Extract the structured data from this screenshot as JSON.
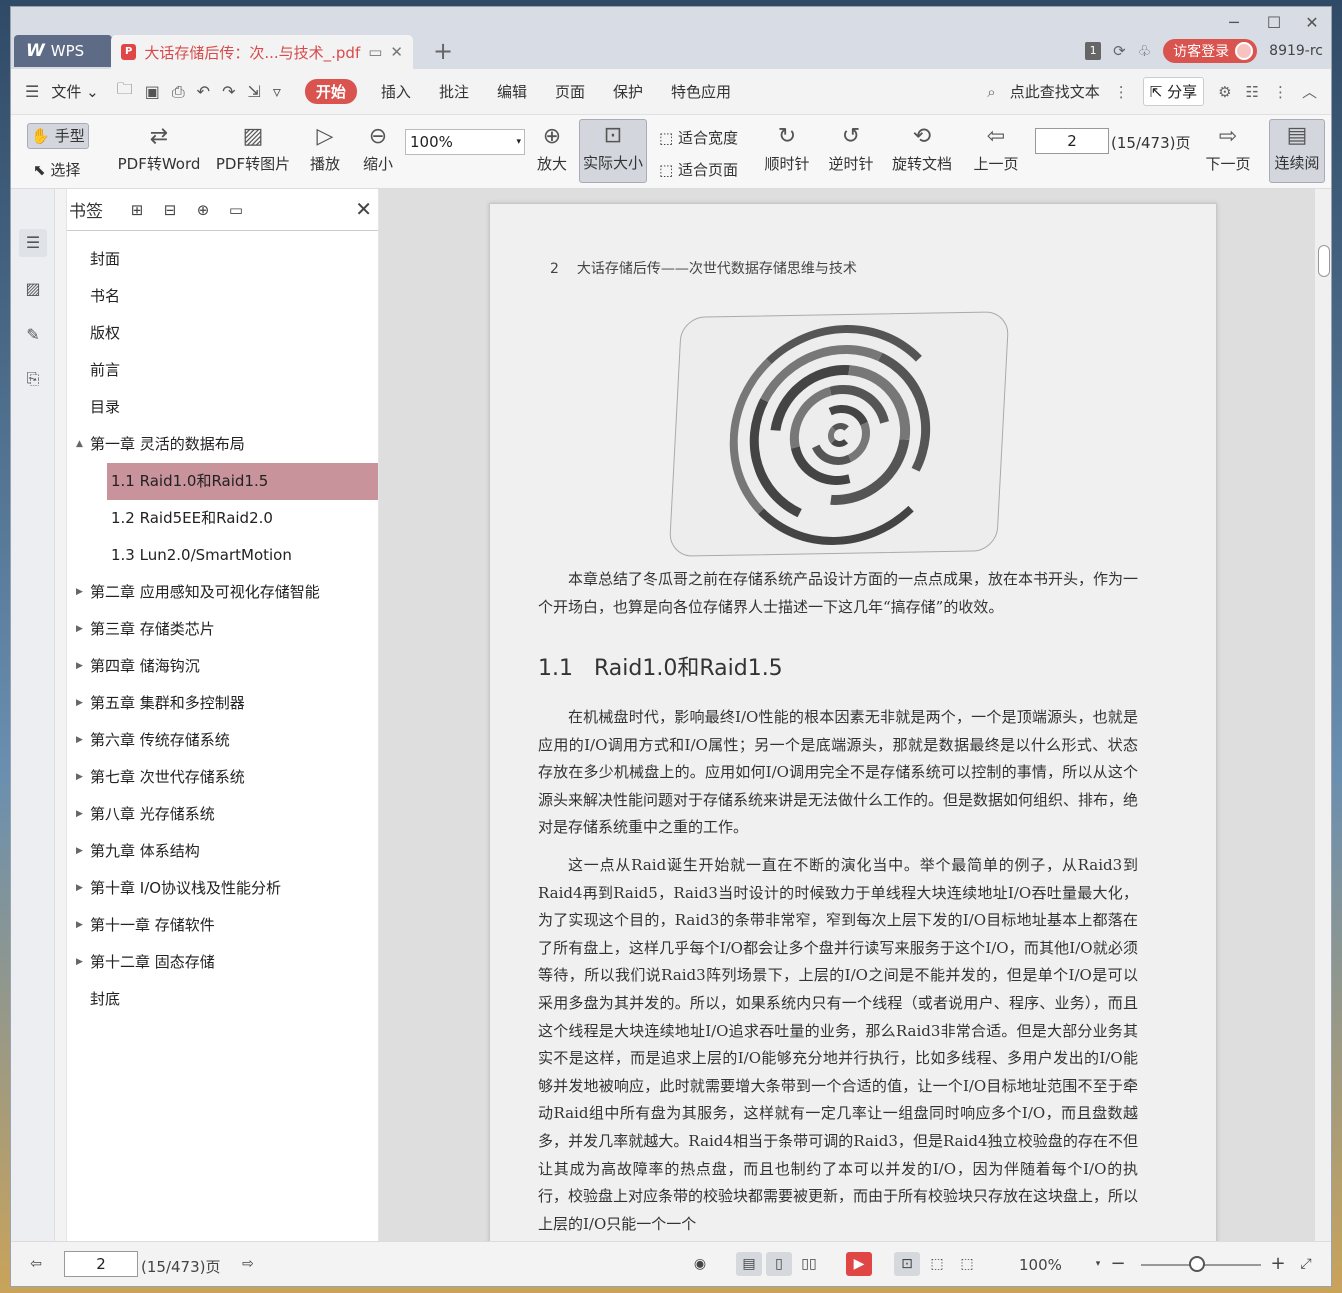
{
  "titlebar": {
    "app_label": "WPS",
    "doc_tab_title": "大话存储后传：次...与技术_.pdf",
    "badge_number": "1",
    "login_label": "访客登录",
    "user_name": "8919-rc"
  },
  "menubar": {
    "file_label": "文件",
    "items": [
      "开始",
      "插入",
      "批注",
      "编辑",
      "页面",
      "保护",
      "特色应用"
    ],
    "search_label": "点此查找文本",
    "share_label": "分享"
  },
  "toolbar": {
    "hand_label": "手型",
    "select_label": "选择",
    "pdf_to_word_label": "PDF转Word",
    "pdf_to_image_label": "PDF转图片",
    "play_label": "播放",
    "zoom_out_label": "缩小",
    "zoom_value": "100%",
    "zoom_in_label": "放大",
    "actual_size_label": "实际大小",
    "fit_width_label": "适合宽度",
    "fit_page_label": "适合页面",
    "clockwise_label": "顺时针",
    "counterclockwise_label": "逆时针",
    "rotate_doc_label": "旋转文档",
    "prev_page_label": "上一页",
    "page_value": "2",
    "page_total": "(15/473)页",
    "next_page_label": "下一页",
    "continuous_label": "连续阅"
  },
  "bookmarks": {
    "title": "书签",
    "items": [
      {
        "label": "封面",
        "level": 0,
        "arrow": ""
      },
      {
        "label": "书名",
        "level": 0,
        "arrow": ""
      },
      {
        "label": "版权",
        "level": 0,
        "arrow": ""
      },
      {
        "label": "前言",
        "level": 0,
        "arrow": ""
      },
      {
        "label": "目录",
        "level": 0,
        "arrow": ""
      },
      {
        "label": "第一章 灵活的数据布局",
        "level": 0,
        "arrow": "▲"
      },
      {
        "label": "1.1 Raid1.0和Raid1.5",
        "level": 1,
        "arrow": "",
        "selected": true
      },
      {
        "label": "1.2 Raid5EE和Raid2.0",
        "level": 1,
        "arrow": ""
      },
      {
        "label": "1.3 Lun2.0/SmartMotion",
        "level": 1,
        "arrow": ""
      },
      {
        "label": "第二章 应用感知及可视化存储智能",
        "level": 0,
        "arrow": "▶"
      },
      {
        "label": "第三章 存储类芯片",
        "level": 0,
        "arrow": "▶"
      },
      {
        "label": "第四章 储海钩沉",
        "level": 0,
        "arrow": "▶"
      },
      {
        "label": "第五章 集群和多控制器",
        "level": 0,
        "arrow": "▶"
      },
      {
        "label": "第六章 传统存储系统",
        "level": 0,
        "arrow": "▶"
      },
      {
        "label": "第七章 次世代存储系统",
        "level": 0,
        "arrow": "▶"
      },
      {
        "label": "第八章 光存储系统",
        "level": 0,
        "arrow": "▶"
      },
      {
        "label": "第九章 体系结构",
        "level": 0,
        "arrow": "▶"
      },
      {
        "label": "第十章 I/O协议栈及性能分析",
        "level": 0,
        "arrow": "▶"
      },
      {
        "label": "第十一章 存储软件",
        "level": 0,
        "arrow": "▶"
      },
      {
        "label": "第十二章 固态存储",
        "level": 0,
        "arrow": "▶"
      },
      {
        "label": "封底",
        "level": 0,
        "arrow": ""
      }
    ]
  },
  "document": {
    "page_number": "2",
    "running_header": "大话存储后传——次世代数据存储思维与技术",
    "intro_para": "本章总结了冬瓜哥之前在存储系统产品设计方面的一点点成果，放在本书开头，作为一个开场白，也算是向各位存储界人士描述一下这几年“搞存储”的收效。",
    "section_number": "1.1",
    "section_title": "Raid1.0和Raid1.5",
    "para1": "在机械盘时代，影响最终I/O性能的根本因素无非就是两个，一个是顶端源头，也就是应用的I/O调用方式和I/O属性；另一个是底端源头，那就是数据最终是以什么形式、状态存放在多少机械盘上的。应用如何I/O调用完全不是存储系统可以控制的事情，所以从这个源头来解决性能问题对于存储系统来讲是无法做什么工作的。但是数据如何组织、排布，绝对是存储系统重中之重的工作。",
    "para2": "这一点从Raid诞生开始就一直在不断的演化当中。举个最简单的例子，从Raid3到Raid4再到Raid5，Raid3当时设计的时候致力于单线程大块连续地址I/O吞吐量最大化，为了实现这个目的，Raid3的条带非常窄，窄到每次上层下发的I/O目标地址基本上都落在了所有盘上，这样几乎每个I/O都会让多个盘并行读写来服务于这个I/O，而其他I/O就必须等待，所以我们说Raid3阵列场景下，上层的I/O之间是不能并发的，但是单个I/O是可以采用多盘为其并发的。所以，如果系统内只有一个线程（或者说用户、程序、业务），而且这个线程是大块连续地址I/O追求吞吐量的业务，那么Raid3非常合适。但是大部分业务其实不是这样，而是追求上层的I/O能够充分地并行执行，比如多线程、多用户发出的I/O能够并发地被响应，此时就需要增大条带到一个合适的值，让一个I/O目标地址范围不至于牵动Raid组中所有盘为其服务，这样就有一定几率让一组盘同时响应多个I/O，而且盘数越多，并发几率就越大。Raid4相当于条带可调的Raid3，但是Raid4独立校验盘的存在不但让其成为高故障率的热点盘，而且也制约了本可以并发的I/O，因为伴随着每个I/O的执行，校验盘上对应条带的校验块都需要被更新，而由于所有校验块只存放在这块盘上，所以上层的I/O只能一个一个"
  },
  "statusbar": {
    "page_value": "2",
    "page_total": "(15/473)页",
    "zoom_value": "100%"
  },
  "colors": {
    "accent": "#d9534f",
    "selected_bookmark": "#c8939a"
  }
}
